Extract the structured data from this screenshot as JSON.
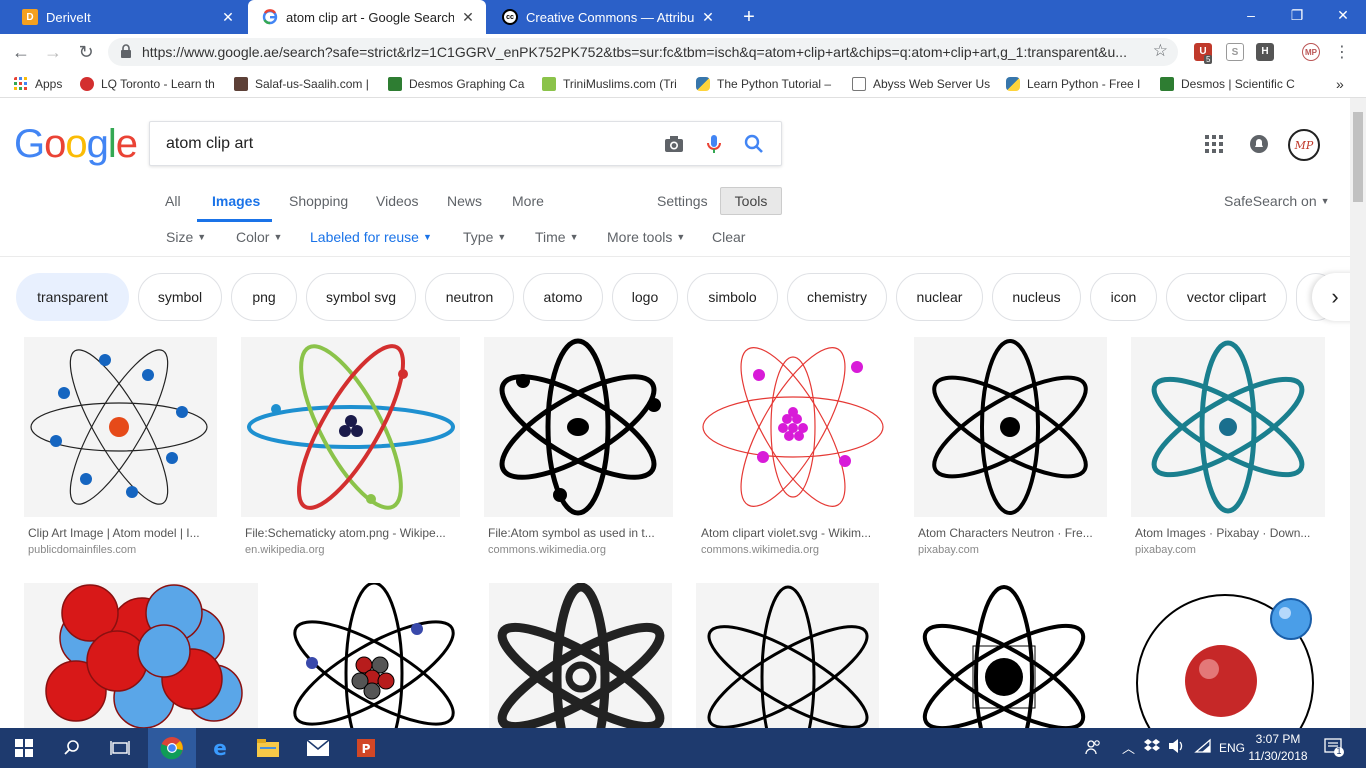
{
  "browser": {
    "tabs": [
      {
        "title": "DeriveIt",
        "favicon": "derive-it-icon",
        "color": "#f4a020"
      },
      {
        "title": "atom clip art - Google Search",
        "favicon": "google-g-icon",
        "color": "#4285f4"
      },
      {
        "title": "Creative Commons — Attribution",
        "favicon": "creative-commons-icon",
        "color": "#000000"
      }
    ],
    "new_tab": "+",
    "window_controls": {
      "minimize": "–",
      "maximize": "❐",
      "close": "✕"
    },
    "url": "https://www.google.ae/search?safe=strict&rlz=1C1GGRV_enPK752PK752&tbs=sur:fc&tbm=isch&q=atom+clip+art&chips=q:atom+clip+art,g_1:transparent&u...",
    "extension_badge": "5",
    "bookmarks": [
      {
        "label": "Apps",
        "icon": "apps-grid-icon"
      },
      {
        "label": "LQ Toronto - Learn th",
        "icon": "lq-icon"
      },
      {
        "label": "Salaf-us-Saalih.com |",
        "icon": "site-icon"
      },
      {
        "label": "Desmos Graphing Ca",
        "icon": "desmos-icon"
      },
      {
        "label": "TriniMuslims.com (Tri",
        "icon": "flag-icon"
      },
      {
        "label": "The Python Tutorial –",
        "icon": "python-icon"
      },
      {
        "label": "Abyss Web Server Us",
        "icon": "page-icon"
      },
      {
        "label": "Learn Python - Free I",
        "icon": "python-icon"
      },
      {
        "label": "Desmos | Scientific C",
        "icon": "desmos-icon"
      }
    ],
    "more_bookmarks": "»"
  },
  "google": {
    "logo": "Google",
    "query": "atom clip art",
    "tabs": [
      "All",
      "Images",
      "Shopping",
      "Videos",
      "News",
      "More"
    ],
    "settings": "Settings",
    "tools": "Tools",
    "safesearch": "SafeSearch on",
    "filters": [
      {
        "label": "Size",
        "caret": "▼"
      },
      {
        "label": "Color",
        "caret": "▼"
      },
      {
        "label": "Labeled for reuse",
        "caret": "▼"
      },
      {
        "label": "Type",
        "caret": "▼"
      },
      {
        "label": "Time",
        "caret": "▼"
      },
      {
        "label": "More tools",
        "caret": "▼"
      }
    ],
    "clear": "Clear",
    "chips": [
      "transparent",
      "symbol",
      "png",
      "symbol svg",
      "neutron",
      "atomo",
      "logo",
      "simbolo",
      "chemistry",
      "nuclear",
      "nucleus",
      "icon",
      "vector clipart"
    ],
    "chip_next": "›",
    "results": [
      {
        "title": "Clip Art Image | Atom model | I...",
        "source": "publicdomainfiles.com"
      },
      {
        "title": "File:Schematicky atom.png - Wikipe...",
        "source": "en.wikipedia.org"
      },
      {
        "title": "File:Atom symbol as used in t...",
        "source": "commons.wikimedia.org"
      },
      {
        "title": "Atom clipart violet.svg - Wikim...",
        "source": "commons.wikimedia.org"
      },
      {
        "title": "Atom Characters Neutron · Fre...",
        "source": "pixabay.com"
      },
      {
        "title": "Atom Images · Pixabay · Down...",
        "source": "pixabay.com"
      }
    ]
  },
  "taskbar": {
    "language": "ENG",
    "time": "3:07 PM",
    "date": "11/30/2018",
    "notification_count": "1"
  },
  "colors": {
    "chrome_blue": "#2b60c8",
    "google_blue": "#1a73e8",
    "taskbar": "#1e3a6e"
  }
}
